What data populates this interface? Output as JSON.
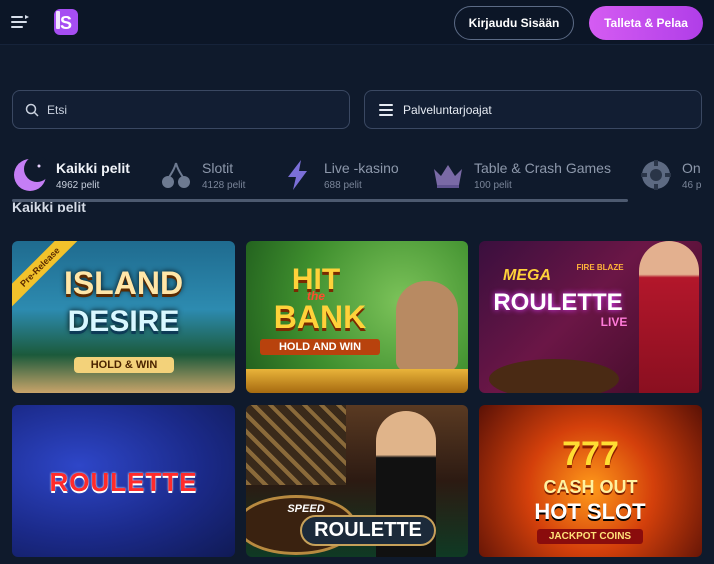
{
  "header": {
    "login_label": "Kirjaudu Sisään",
    "deposit_label": "Talleta & Pelaa"
  },
  "search": {
    "placeholder": "Etsi"
  },
  "providers": {
    "label": "Palveluntarjoajat"
  },
  "categories": [
    {
      "name": "Kaikki pelit",
      "count": "4962 pelit",
      "icon": "moon-icon",
      "active": true
    },
    {
      "name": "Slotit",
      "count": "4128 pelit",
      "icon": "cherries-icon",
      "active": false
    },
    {
      "name": "Live -kasino",
      "count": "688 pelit",
      "icon": "lightning-icon",
      "active": false
    },
    {
      "name": "Table & Crash Games",
      "count": "100 pelit",
      "icon": "crown-icon",
      "active": false
    },
    {
      "name": "On",
      "count": "46 p",
      "icon": "chip-icon",
      "active": false
    }
  ],
  "section": {
    "title": "Kaikki pelit"
  },
  "games": [
    {
      "title_line1": "ISLAND",
      "title_line2": "DESIRE",
      "tag": "HOLD & WIN",
      "badge": "Pre-Release"
    },
    {
      "title_line1": "HIT",
      "title_line2": "BANK",
      "small": "the",
      "tag": "HOLD AND WIN"
    },
    {
      "title_line1": "MEGA",
      "title_line2": "ROULETTE",
      "small": "FIRE BLAZE",
      "tag": "LIVE"
    },
    {
      "title_line1": "ROULETTE"
    },
    {
      "title_line1": "SPEED",
      "title_line2": "ROULETTE"
    },
    {
      "title_line1": "777",
      "title_line2": "CASH OUT",
      "small": "HOT SLOT",
      "tag": "JACKPOT COINS"
    }
  ],
  "colors": {
    "background": "#0f1a2c",
    "accent": "#c24ef0",
    "border": "#3a4862"
  }
}
